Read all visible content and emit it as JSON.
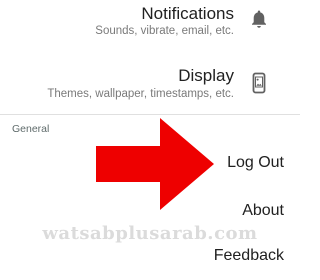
{
  "settings": {
    "notifications": {
      "title": "Notifications",
      "subtitle": "Sounds, vibrate, email, etc.",
      "icon": "bell-icon"
    },
    "display": {
      "title": "Display",
      "subtitle": "Themes, wallpaper, timestamps, etc.",
      "icon": "phone-icon"
    },
    "general_section": {
      "header": "General",
      "items": [
        {
          "label": "Log Out"
        },
        {
          "label": "About"
        },
        {
          "label": "Feedback"
        }
      ]
    }
  },
  "annotation": {
    "arrow_color": "#ee0000",
    "watermark": "watsabplusarab.com"
  },
  "colors": {
    "title": "#212121",
    "subtitle": "#7a7a7a",
    "icon": "#616161",
    "divider": "#e0e0e0"
  }
}
